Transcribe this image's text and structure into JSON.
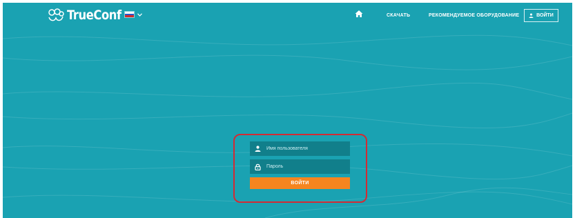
{
  "brand": {
    "name": "TrueConf"
  },
  "language": {
    "flag_colors": [
      "#ffffff",
      "#2b54c8",
      "#d22a2a"
    ]
  },
  "nav": {
    "download": "СКАЧАТЬ",
    "equipment": "РЕКОМЕНДУЕМОЕ ОБОРУДОВАНИЕ",
    "login": "ВОЙТИ"
  },
  "login_form": {
    "username_placeholder": "Имя пользователя",
    "password_placeholder": "Пароль",
    "submit_label": "ВОЙТИ"
  },
  "colors": {
    "background": "#1aa2b2",
    "field": "#117f8b",
    "submit": "#f6851f",
    "highlight": "#d42a33"
  },
  "icons": [
    "trueconf-logo-icon",
    "home-icon",
    "chevron-down-icon",
    "user-icon",
    "lock-icon"
  ]
}
